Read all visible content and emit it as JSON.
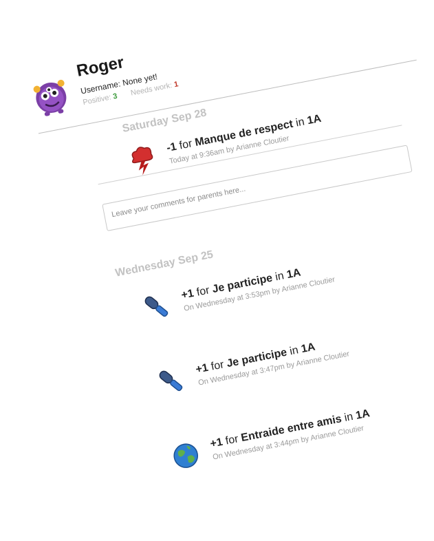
{
  "student": {
    "name": "Roger",
    "username_label": "Username: None yet!",
    "positive_label": "Positive:",
    "positive_value": "3",
    "needs_work_label": "Needs work:",
    "needs_work_value": "1",
    "avatar_icon": "purple-monster-icon"
  },
  "groups": [
    {
      "date": "Saturday Sep 28",
      "entries": [
        {
          "points": "-1",
          "for": "for",
          "behavior": "Manque de respect",
          "in": "in",
          "class": "1A",
          "meta": "Today at 9:36am by Arianne Cloutier",
          "icon": "red-thunder-cloud-icon"
        }
      ],
      "comment_placeholder": "Leave your comments for parents here..."
    },
    {
      "date": "Wednesday Sep 25",
      "entries": [
        {
          "points": "+1",
          "for": "for",
          "behavior": "Je participe",
          "in": "in",
          "class": "1A",
          "meta": "On Wednesday at 3:53pm by Arianne Cloutier",
          "icon": "microphone-icon"
        },
        {
          "points": "+1",
          "for": "for",
          "behavior": "Je participe",
          "in": "in",
          "class": "1A",
          "meta": "On Wednesday at 3:47pm by Arianne Cloutier",
          "icon": "microphone-icon"
        },
        {
          "points": "+1",
          "for": "for",
          "behavior": "Entraide entre amis",
          "in": "in",
          "class": "1A",
          "meta": "On Wednesday at 3:44pm by Arianne Cloutier",
          "icon": "globe-icon"
        }
      ]
    }
  ],
  "colors": {
    "positive": "#3c9b3c",
    "needs_work": "#c0392b",
    "date_heading": "#c2c2c2"
  }
}
